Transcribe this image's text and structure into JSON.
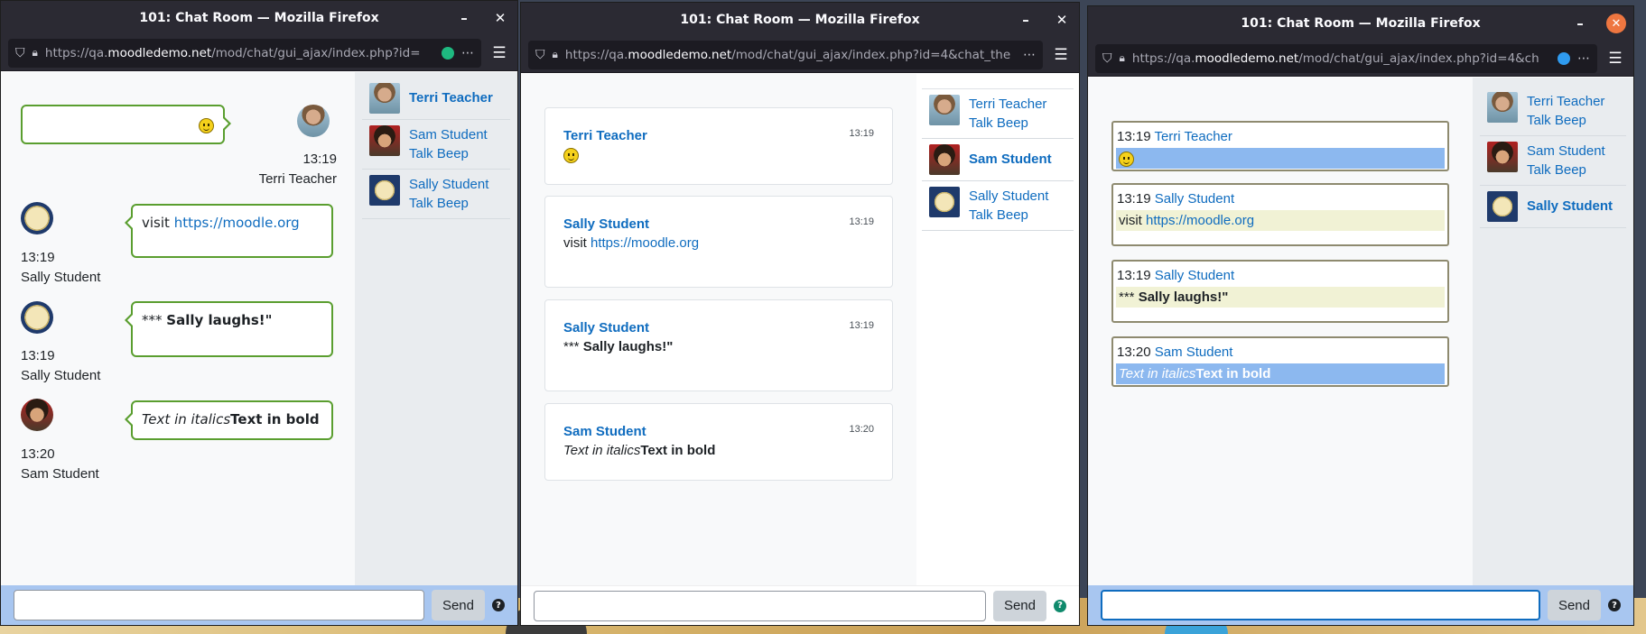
{
  "window_title": "101: Chat Room — Mozilla Firefox",
  "icons": {
    "minimize": "–",
    "close": "✕",
    "shield": "⛉",
    "lock": "🔒",
    "more": "⋯",
    "menu": "☰",
    "help": "?"
  },
  "send_label": "Send",
  "windows": [
    {
      "url_pre": "https://qa.",
      "url_host": "moodledemo.net",
      "url_post": "/mod/chat/gui_ajax/index.php?id=",
      "indicator_color": "#1eb980",
      "users": [
        {
          "name": "Terri Teacher",
          "action": "",
          "bold": true
        },
        {
          "name": "Sam Student",
          "action": "Talk Beep"
        },
        {
          "name": "Sally Student",
          "action": "Talk Beep"
        }
      ],
      "messages": [
        {
          "time": "13:19",
          "author": "Terri Teacher",
          "text": ""
        },
        {
          "time": "13:19",
          "author": "Sally Student",
          "text_pre": "visit ",
          "link": "https://moodle.org"
        },
        {
          "time": "13:19",
          "author": "Sally Student",
          "text_pre": "*** ",
          "bold": "Sally laughs!\""
        },
        {
          "time": "13:20",
          "author": "Sam Student",
          "italic": "Text in italics",
          "bold": "Text in bold"
        }
      ]
    },
    {
      "url_pre": "https://qa.",
      "url_host": "moodledemo.net",
      "url_post": "/mod/chat/gui_ajax/index.php?id=4&chat_the",
      "users": [
        {
          "name": "Terri Teacher",
          "action": "Talk Beep"
        },
        {
          "name": "Sam Student",
          "action": "",
          "bold": true
        },
        {
          "name": "Sally Student",
          "action": "Talk Beep"
        }
      ],
      "messages": [
        {
          "time": "13:19",
          "author": "Terri Teacher",
          "text": ""
        },
        {
          "time": "13:19",
          "author": "Sally Student",
          "text_pre": "visit ",
          "link": "https://moodle.org"
        },
        {
          "time": "13:19",
          "author": "Sally Student",
          "text_pre": "*** ",
          "bold": "Sally laughs!\""
        },
        {
          "time": "13:20",
          "author": "Sam Student",
          "italic": "Text in italics",
          "bold": "Text in bold"
        }
      ]
    },
    {
      "url_pre": "https://qa.",
      "url_host": "moodledemo.net",
      "url_post": "/mod/chat/gui_ajax/index.php?id=4&ch",
      "indicator_color": "#2f9bf0",
      "users": [
        {
          "name": "Terri Teacher",
          "action": "Talk Beep"
        },
        {
          "name": "Sam Student",
          "action": "Talk Beep"
        },
        {
          "name": "Sally Student",
          "action": "",
          "bold": true
        }
      ],
      "messages": [
        {
          "time": "13:19",
          "author": "Terri Teacher",
          "text": ""
        },
        {
          "time": "13:19",
          "author": "Sally Student",
          "text_pre": "visit ",
          "link": "https://moodle.org"
        },
        {
          "time": "13:19",
          "author": "Sally Student",
          "text_pre": "*** ",
          "bold": "Sally laughs!\""
        },
        {
          "time": "13:20",
          "author": "Sam Student",
          "italic": "Text in italics",
          "bold": "Text in bold"
        }
      ]
    }
  ],
  "colors": {
    "link": "#0f6cbf",
    "bubble_border": "#5a9e2f",
    "highlight_blue": "#8cb8ef",
    "highlight_yellow": "#f1f2d5",
    "send_bar": "#a8c6f0"
  }
}
